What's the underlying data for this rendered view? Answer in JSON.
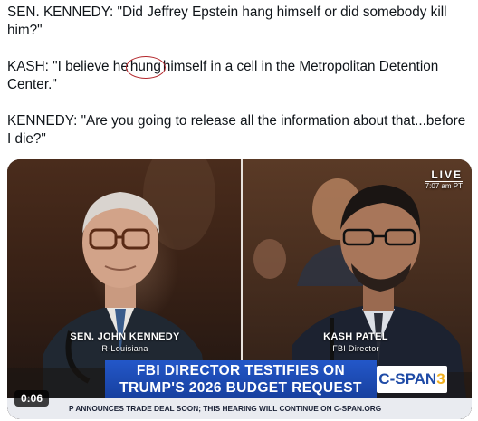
{
  "tweet": {
    "line1": "SEN. KENNEDY: \"Did Jeffrey Epstein hang himself or did somebody kill him?\"",
    "line2_before": "KASH: \"I believe he",
    "line2_circled": "hung",
    "line2_after": "himself in a cell in the Metropolitan Detention Center.\"",
    "line3": "KENNEDY: \"Are you going to release all the information about that...before I die?\""
  },
  "video": {
    "live_label": "LIVE",
    "live_time": "7:07 am PT",
    "left_name": "SEN. JOHN KENNEDY",
    "left_sub": "R-Louisiana",
    "right_name": "KASH PATEL",
    "right_sub": "FBI Director",
    "headline_line1": "FBI DIRECTOR TESTIFIES ON",
    "headline_line2": "TRUMP'S 2026 BUDGET REQUEST",
    "network_prefix": "C-SPAN",
    "network_number": "3",
    "ticker": "P ANNOUNCES TRADE DEAL SOON; THIS HEARING WILL CONTINUE ON C-SPAN.ORG",
    "duration": "0:06"
  },
  "colors": {
    "annotation_circle": "#b3262b",
    "headline_blue": "#1f4fb8",
    "cspan_yellow": "#f2b01e"
  }
}
